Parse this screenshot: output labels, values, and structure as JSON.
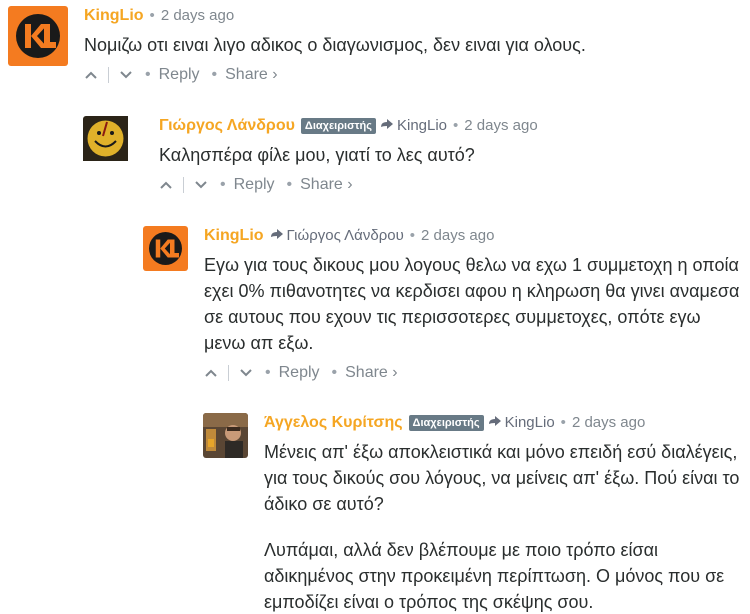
{
  "colors": {
    "author": "#f5a623",
    "badge": "#687a86",
    "meta": "#7f878e"
  },
  "comments": [
    {
      "author": "KingLio",
      "avatar": "kinglio-logo-avatar",
      "time": "2 days ago",
      "text": [
        "Νομιζω οτι ειναι λιγο αδικος ο διαγωνισμος, δεν ειναι για ολους."
      ],
      "reply": "Reply",
      "share": "Share ›"
    },
    {
      "author": "Γιώργος Λάνδρου",
      "badge": "Διαχειριστής",
      "avatar": "smiley-avatar",
      "parent": "KingLio",
      "time": "2 days ago",
      "text": [
        "Καλησπέρα φίλε μου, γιατί το λες αυτό?"
      ],
      "reply": "Reply",
      "share": "Share ›"
    },
    {
      "author": "KingLio",
      "avatar": "kinglio-logo-avatar",
      "parent": "Γιώργος Λάνδρου",
      "time": "2 days ago",
      "text": [
        "Εγω για τους δικους μου λογους θελω να εχω 1 συμμετοχη η οποία εχει 0% πιθανοτητες να κερδισει αφου η κληρωση θα γινει αναμεσα σε αυτους που εχουν τις περισσοτερες συμμετοχες, οπότε εγω μενω απ εξω."
      ],
      "reply": "Reply",
      "share": "Share ›"
    },
    {
      "author": "Άγγελος Κυρίτσης",
      "badge": "Διαχειριστής",
      "avatar": "photo-avatar",
      "parent": "KingLio",
      "time": "2 days ago",
      "text": [
        "Μένεις απ' έξω αποκλειστικά και μόνο επειδή εσύ διαλέγεις, για τους δικούς σου λόγους, να μείνεις απ' έξω. Πού είναι το άδικο σε αυτό?",
        "Λυπάμαι, αλλά δεν βλέπουμε με ποιο τρόπο είσαι αδικημένος στην προκειμένη περίπτωση. Ο μόνος που σε εμποδίζει είναι ο τρόπος της σκέψης σου."
      ]
    }
  ]
}
